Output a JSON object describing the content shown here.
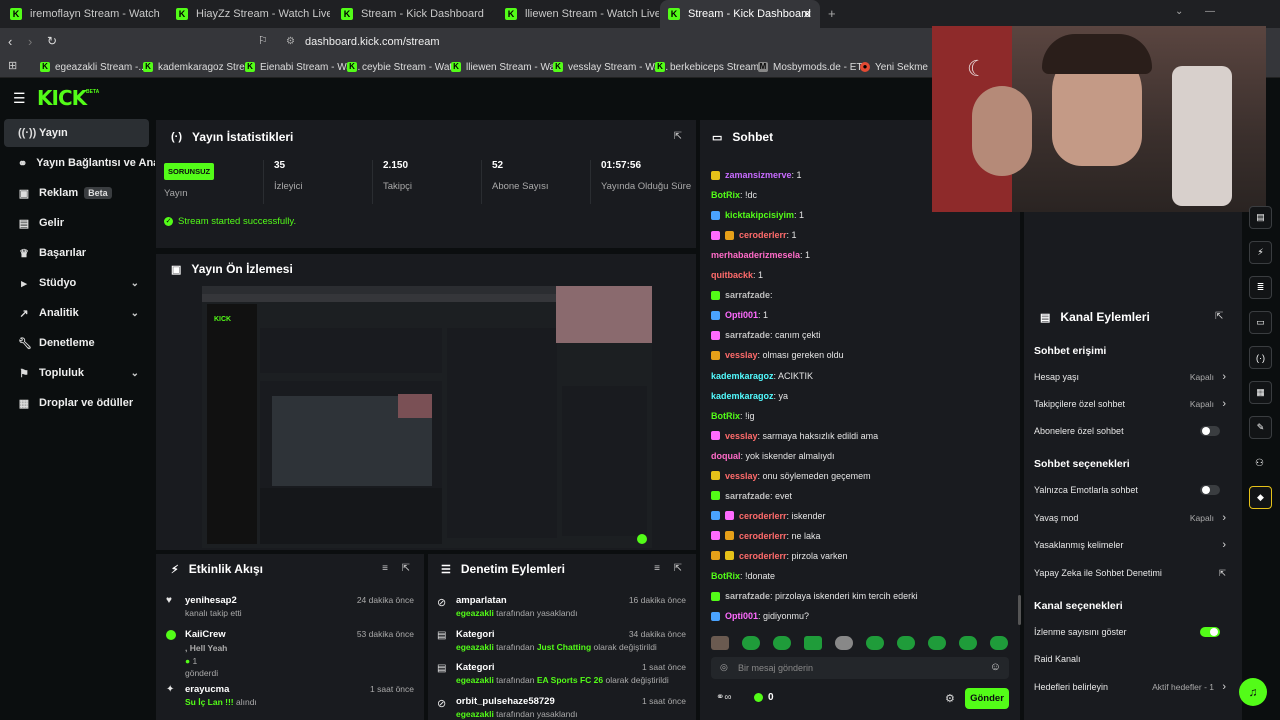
{
  "browser": {
    "tabs": [
      {
        "label": "iremoflayn Stream - Watch Live on K",
        "active": false
      },
      {
        "label": "HiayZz Stream - Watch Live on Kick",
        "active": false
      },
      {
        "label": "Stream - Kick Dashboard",
        "active": false
      },
      {
        "label": "lliewen Stream - Watch Live on Kick",
        "active": false
      },
      {
        "label": "Stream - Kick Dashboard",
        "active": true
      }
    ],
    "url": "dashboard.kick.com/stream",
    "bookmarks": [
      "egeazakli Stream -...",
      "kademkaragoz Stre...",
      "Eienabi Stream - Wa...",
      "ceybie Stream - Wat...",
      "lliewen Stream - Wa...",
      "vesslay Stream - Wa...",
      "berkebiceps Stream...",
      "Mosbymods.de - ET...",
      "Yeni Sekme"
    ]
  },
  "brand": {
    "logo": "KICK",
    "logo_tag": "BETA",
    "accent": "#53fc18"
  },
  "sidebar": {
    "items": [
      {
        "label": "Yayın",
        "icon": "broadcast-icon",
        "active": true
      },
      {
        "label": "Yayın Bağlantısı ve Anahtar",
        "icon": "link-icon"
      },
      {
        "label": "Reklam",
        "icon": "ad-icon",
        "badge": "Beta"
      },
      {
        "label": "Gelir",
        "icon": "wallet-icon"
      },
      {
        "label": "Başarılar",
        "icon": "trophy-icon"
      },
      {
        "label": "Stüdyo",
        "icon": "studio-icon",
        "expandable": true
      },
      {
        "label": "Analitik",
        "icon": "analytics-icon",
        "expandable": true
      },
      {
        "label": "Denetleme",
        "icon": "wrench-icon"
      },
      {
        "label": "Topluluk",
        "icon": "community-icon",
        "expandable": true
      },
      {
        "label": "Droplar ve ödüller",
        "icon": "gift-icon"
      }
    ]
  },
  "stats": {
    "title": "Yayın İstatistikleri",
    "status_badge": "SORUNSUZ",
    "status_label": "Yayın",
    "items": [
      {
        "value": "35",
        "label": "İzleyici"
      },
      {
        "value": "2.150",
        "label": "Takipçi"
      },
      {
        "value": "52",
        "label": "Abone Sayısı"
      },
      {
        "value": "01:57:56",
        "label": "Yayında Olduğu Süre"
      }
    ],
    "success_message": "Stream started successfully."
  },
  "preview": {
    "title": "Yayın Ön İzlemesi"
  },
  "activity": {
    "title": "Etkinlik Akışı",
    "items": [
      {
        "name": "yenihesap2",
        "detail": "kanalı takip etti",
        "time": "24 dakika önce",
        "icon": "heart-icon"
      },
      {
        "name": "KaiiCrew",
        "line2": ", Hell Yeah",
        "line3": "1",
        "line4": "gönderdi",
        "time": "53 dakika önce",
        "icon": "kick-coin-icon"
      },
      {
        "name": "erayucma",
        "detail_green": "Su İç Lan !!!",
        "detail": " alındı",
        "time": "1 saat önce",
        "icon": "reward-icon"
      }
    ]
  },
  "moderation": {
    "title": "Denetim Eylemleri",
    "items": [
      {
        "name": "amparlatan",
        "actor": "egeazakli",
        "detail": " tarafından yasaklandı",
        "time": "16 dakika önce",
        "icon": "ban-icon"
      },
      {
        "name": "Kategori",
        "actor": "egeazakli",
        "detail": " tarafından ",
        "category": "Just Chatting",
        "detail2": " olarak değiştirildi",
        "time": "34 dakika önce",
        "icon": "category-icon"
      },
      {
        "name": "Kategori",
        "actor": "egeazakli",
        "detail": " tarafından ",
        "category": "EA Sports FC 26",
        "detail2": " olarak değiştirildi",
        "time": "1 saat önce",
        "icon": "category-icon"
      },
      {
        "name": "orbit_pulsehaze58729",
        "actor": "egeazakli",
        "detail": " tarafından yasaklandı",
        "time": "1 saat önce",
        "icon": "ban-icon"
      }
    ]
  },
  "chat": {
    "title": "Sohbet",
    "messages": [
      {
        "user": "zamansizmerve",
        "color": "#c86bff",
        "text": ": 1"
      },
      {
        "user": "BotRix",
        "color": "#53fc18",
        "text": ": !dc"
      },
      {
        "user": "kicktakipcisiyim",
        "color": "#53fc18",
        "text": ": 1"
      },
      {
        "user": "ceroderlerr",
        "color": "#ff6b6b",
        "text": ": 1"
      },
      {
        "user": "merhabaderizmesela",
        "color": "#ff6bc8",
        "text": ": 1"
      },
      {
        "user": "quitbackk",
        "color": "#ff6b6b",
        "text": ": 1"
      },
      {
        "user": "sarrafzade",
        "color": "#bdbdbd",
        "text": ":"
      },
      {
        "user": "Opti001",
        "color": "#ff6bff",
        "text": ": 1"
      },
      {
        "user": "sarrafzade",
        "color": "#bdbdbd",
        "text": ": canım çekti"
      },
      {
        "user": "vesslay",
        "color": "#ff6b6b",
        "text": ": olması gereken oldu"
      },
      {
        "user": "kademkaragoz",
        "color": "#53fcff",
        "text": ": ACIKTIK"
      },
      {
        "user": "kademkaragoz",
        "color": "#53fcff",
        "text": ": ya"
      },
      {
        "user": "BotRix",
        "color": "#53fc18",
        "text": ": !ig"
      },
      {
        "user": "vesslay",
        "color": "#ff6b6b",
        "text": ": sarmaya haksızlık edildi ama"
      },
      {
        "user": "doqual",
        "color": "#ff6bc8",
        "text": ": yok iskender almalıydı"
      },
      {
        "user": "vesslay",
        "color": "#ff6b6b",
        "text": ": onu söylemeden geçemem"
      },
      {
        "user": "sarrafzade",
        "color": "#bdbdbd",
        "text": ": evet"
      },
      {
        "user": "ceroderlerr",
        "color": "#ff6b6b",
        "text": ": iskender"
      },
      {
        "user": "ceroderlerr",
        "color": "#ff6b6b",
        "text": ": ne laka"
      },
      {
        "user": "ceroderlerr",
        "color": "#ff6b6b",
        "text": ": pirzola varken"
      },
      {
        "user": "BotRix",
        "color": "#53fc18",
        "text": ": !donate"
      },
      {
        "user": "sarrafzade",
        "color": "#bdbdbd",
        "text": ": pirzolaya iskenderi kim tercih ederki"
      },
      {
        "user": "Opti001",
        "color": "#ff6bff",
        "text": ": gidiyonmu?"
      }
    ],
    "input_placeholder": "Bir mesaj gönderin",
    "points": "0",
    "send_label": "Gönder"
  },
  "channel_actions": {
    "title": "Kanal Eylemleri",
    "sections": [
      {
        "heading": "Sohbet erişimi"
      },
      {
        "label": "Hesap yaşı",
        "value": "Kapalı",
        "kind": "nav"
      },
      {
        "label": "Takipçilere özel sohbet",
        "value": "Kapalı",
        "kind": "nav"
      },
      {
        "label": "Abonelere özel sohbet",
        "kind": "toggle",
        "on": false
      },
      {
        "heading": "Sohbet seçenekleri"
      },
      {
        "label": "Yalnızca Emotlarla sohbet",
        "kind": "toggle",
        "on": false
      },
      {
        "label": "Yavaş mod",
        "value": "Kapalı",
        "kind": "nav"
      },
      {
        "label": "Yasaklanmış kelimeler",
        "kind": "nav"
      },
      {
        "label": "Yapay Zeka ile Sohbet Denetimi",
        "kind": "ext"
      },
      {
        "heading": "Kanal seçenekleri"
      },
      {
        "label": "İzlenme sayısını göster",
        "kind": "toggle",
        "on": true
      },
      {
        "label": "Raid Kanalı",
        "kind": "plain"
      },
      {
        "label": "Hedefleri belirleyin",
        "value": "Aktif hedefler - 1",
        "kind": "nav"
      }
    ]
  }
}
